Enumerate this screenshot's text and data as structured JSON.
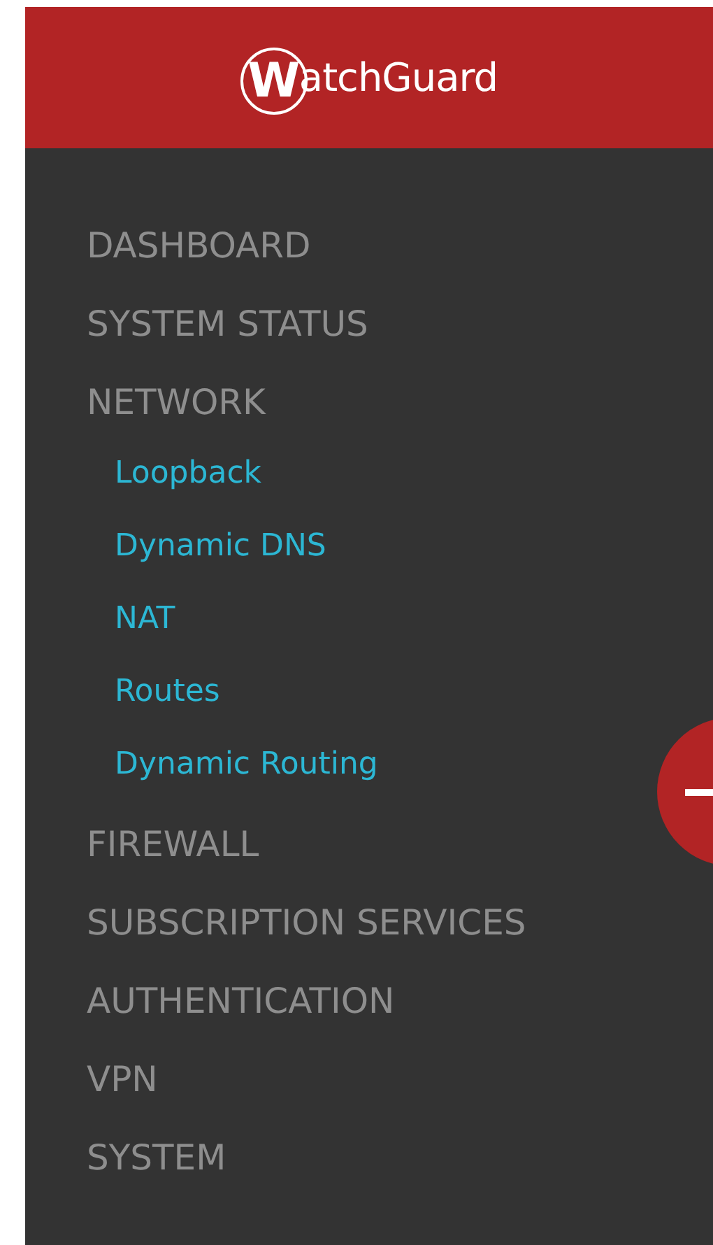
{
  "header": {
    "logo_mark": "W",
    "logo_text": "atchGuard"
  },
  "menu": [
    {
      "label": "DASHBOARD"
    },
    {
      "label": "SYSTEM STATUS"
    },
    {
      "label": "NETWORK",
      "children": [
        {
          "label": "Loopback"
        },
        {
          "label": "Dynamic DNS"
        },
        {
          "label": "NAT"
        },
        {
          "label": "Routes"
        },
        {
          "label": "Dynamic Routing"
        }
      ]
    },
    {
      "label": "FIREWALL"
    },
    {
      "label": "SUBSCRIPTION SERVICES"
    },
    {
      "label": "AUTHENTICATION"
    },
    {
      "label": "VPN"
    },
    {
      "label": "SYSTEM"
    }
  ]
}
